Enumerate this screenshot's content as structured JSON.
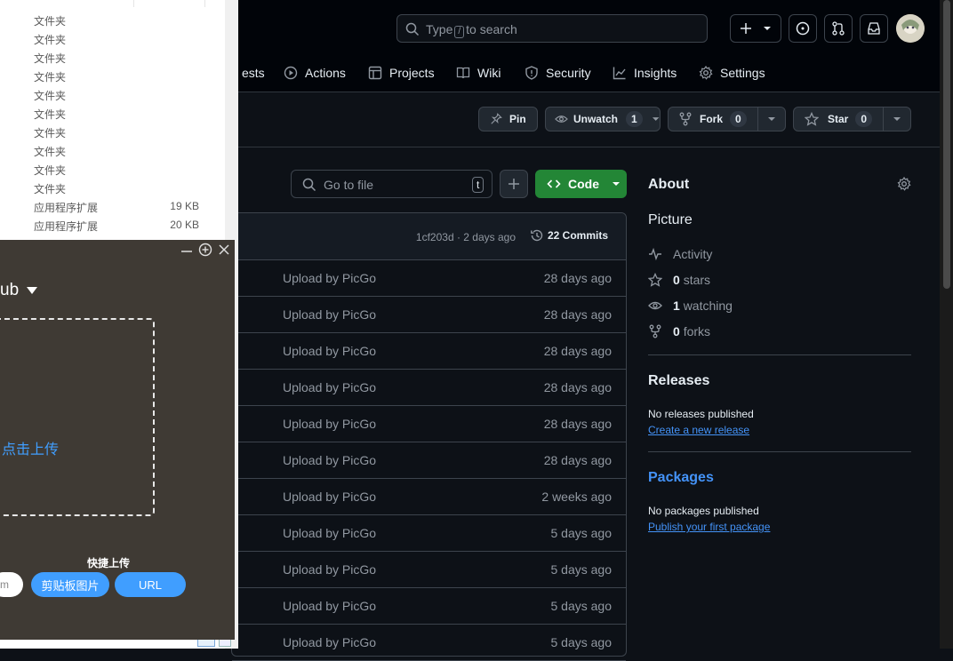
{
  "github": {
    "search": {
      "type_label": "Type",
      "key": "/",
      "suffix": "to search"
    },
    "nav": [
      {
        "label": "ests",
        "icon": "pull-request-tab-cut"
      },
      {
        "label": "Actions",
        "icon": "play-icon"
      },
      {
        "label": "Projects",
        "icon": "table-icon"
      },
      {
        "label": "Wiki",
        "icon": "book-icon"
      },
      {
        "label": "Security",
        "icon": "shield-icon"
      },
      {
        "label": "Insights",
        "icon": "graph-icon"
      },
      {
        "label": "Settings",
        "icon": "gear-icon"
      }
    ],
    "actions": {
      "pin": "Pin",
      "unwatch": "Unwatch",
      "unwatch_count": "1",
      "fork": "Fork",
      "fork_count": "0",
      "star": "Star",
      "star_count": "0"
    },
    "file_search_placeholder": "Go to file",
    "file_search_key": "t",
    "code_label": "Code",
    "commit": {
      "hash_age": "1cf203d · 2 days ago",
      "commits": "22 Commits"
    },
    "rows": [
      {
        "msg": "Upload by PicGo",
        "age": "28 days ago"
      },
      {
        "msg": "Upload by PicGo",
        "age": "28 days ago"
      },
      {
        "msg": "Upload by PicGo",
        "age": "28 days ago"
      },
      {
        "msg": "Upload by PicGo",
        "age": "28 days ago"
      },
      {
        "msg": "Upload by PicGo",
        "age": "28 days ago"
      },
      {
        "msg": "Upload by PicGo",
        "age": "28 days ago"
      },
      {
        "msg": "Upload by PicGo",
        "age": "2 weeks ago"
      },
      {
        "msg": "Upload by PicGo",
        "age": "5 days ago"
      },
      {
        "msg": "Upload by PicGo",
        "age": "5 days ago"
      },
      {
        "msg": "Upload by PicGo",
        "age": "5 days ago"
      },
      {
        "msg": "Upload by PicGo",
        "age": "5 days ago"
      }
    ],
    "about": {
      "title": "About",
      "description": "Picture",
      "activity": "Activity",
      "stars_num": "0",
      "stars": "stars",
      "watching_num": "1",
      "watching": "watching",
      "forks_num": "0",
      "forks": "forks",
      "releases_title": "Releases",
      "no_releases": "No releases published",
      "create_release": "Create a new release",
      "packages_title": "Packages",
      "no_packages": "No packages published",
      "publish_package": "Publish your first package"
    }
  },
  "explorer": {
    "rows": [
      {
        "name": "文件夹",
        "size": ""
      },
      {
        "name": "文件夹",
        "size": ""
      },
      {
        "name": "文件夹",
        "size": ""
      },
      {
        "name": "文件夹",
        "size": ""
      },
      {
        "name": "文件夹",
        "size": ""
      },
      {
        "name": "文件夹",
        "size": ""
      },
      {
        "name": "文件夹",
        "size": ""
      },
      {
        "name": "文件夹",
        "size": ""
      },
      {
        "name": "文件夹",
        "size": ""
      },
      {
        "name": "文件夹",
        "size": ""
      },
      {
        "name": "应用程序扩展",
        "size": "19 KB"
      },
      {
        "name": "应用程序扩展",
        "size": "20 KB"
      }
    ]
  },
  "picgo": {
    "uploader": "ub",
    "drop_text": "点击上传",
    "quick_upload": "快捷上传",
    "input_suffix": "m",
    "clipboard_btn": "剪贴板图片",
    "url_btn": "URL"
  },
  "colors": {
    "accent_green": "#238636",
    "link_blue": "#4493f8",
    "picgo_blue": "#409eff",
    "picgo_bg": "#3f3a34"
  }
}
